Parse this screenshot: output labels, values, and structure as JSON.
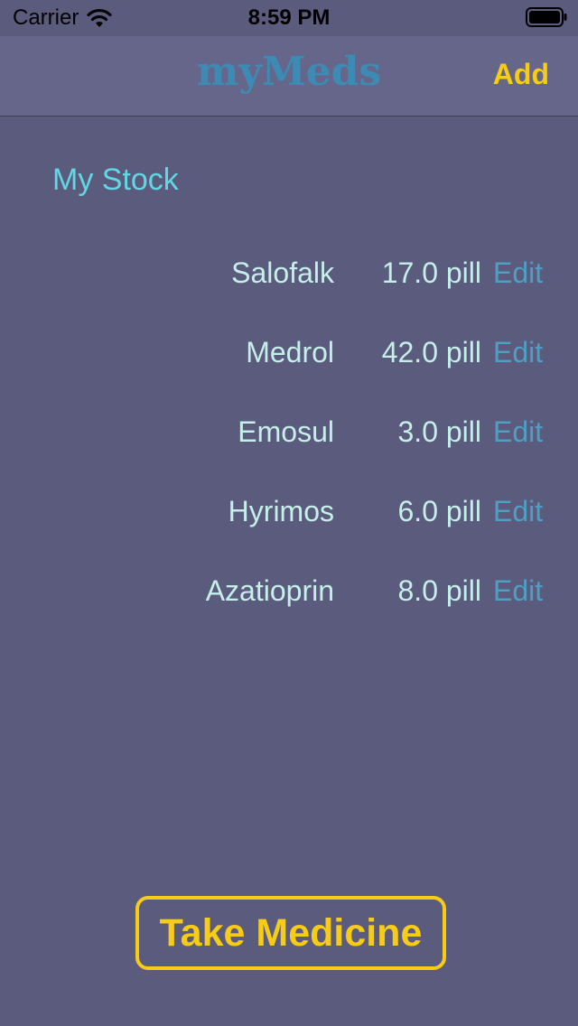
{
  "status_bar": {
    "carrier": "Carrier",
    "time": "8:59 PM",
    "icons": [
      "wifi-icon",
      "battery-icon"
    ]
  },
  "nav": {
    "title": "myMeds",
    "add_label": "Add"
  },
  "section": {
    "title": "My Stock"
  },
  "stock": [
    {
      "name": "Salofalk",
      "amount": "17.0 pill",
      "edit": "Edit"
    },
    {
      "name": "Medrol",
      "amount": "42.0 pill",
      "edit": "Edit"
    },
    {
      "name": "Emosul",
      "amount": "3.0 pill",
      "edit": "Edit"
    },
    {
      "name": "Hyrimos",
      "amount": "6.0 pill",
      "edit": "Edit"
    },
    {
      "name": "Azatioprin",
      "amount": "8.0 pill",
      "edit": "Edit"
    }
  ],
  "actions": {
    "take_medicine": "Take Medicine"
  },
  "colors": {
    "background": "#5b5b7e",
    "nav_background": "#66668a",
    "title": "#3d8bb4",
    "accent": "#f7cc17",
    "section_title": "#62d6e2",
    "text": "#c6efe9",
    "edit": "#4f9ec3"
  }
}
